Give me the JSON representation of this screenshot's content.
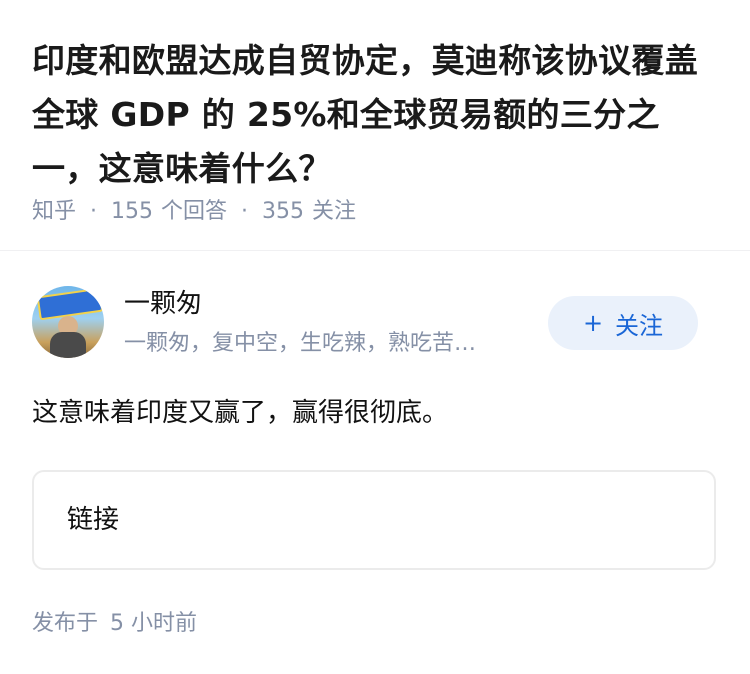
{
  "question": {
    "title": "印度和欧盟达成自贸协定，莫迪称该协议覆盖全球 GDP 的 25%和全球贸易额的三分之一，这意味着什么？",
    "source": "知乎",
    "answers_count": "155",
    "answers_label": "个回答",
    "followers_count": "355",
    "followers_label": "关注"
  },
  "author": {
    "name": "一颗匆",
    "bio": "一颗匆，复中空，生吃辣，熟吃苦…",
    "follow_plus": "+",
    "follow_label": "关注"
  },
  "answer": {
    "text": "这意味着印度又赢了，赢得很彻底。",
    "link_label": "链接"
  },
  "footer": {
    "published_label": "发布于",
    "published_time": "5 小时前"
  }
}
